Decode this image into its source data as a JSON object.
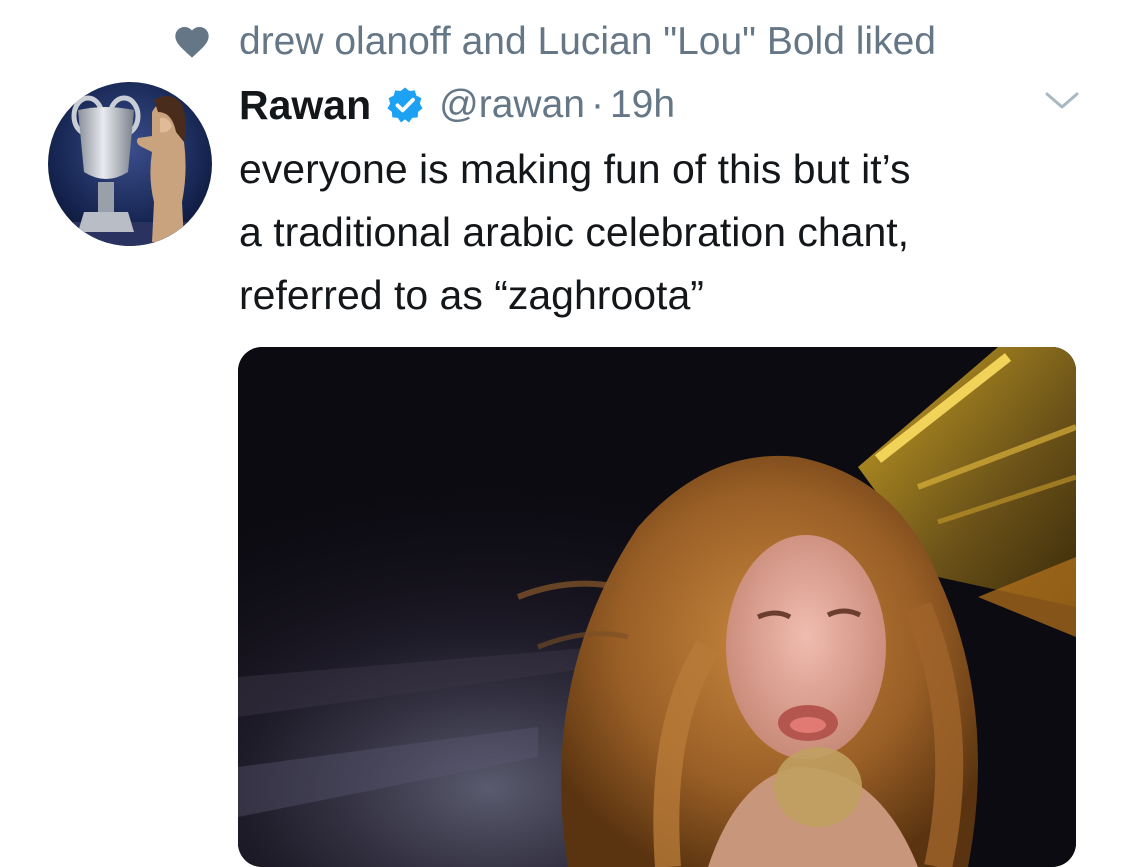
{
  "social_context": {
    "icon": "heart-icon",
    "text": "drew olanoff and Lucian \"Lou\" Bold liked"
  },
  "tweet": {
    "display_name": "Rawan",
    "verified_icon": "verified-badge-icon",
    "handle": "@rawan",
    "separator": "·",
    "time": "19h",
    "menu_icon": "chevron-down-icon",
    "text_lines": [
      "everyone is making fun of this but it’s",
      "a traditional arabic celebration chant,",
      "referred to as “zaghroota”"
    ]
  },
  "colors": {
    "primary_text": "#14171a",
    "secondary_text": "#657786",
    "verified_blue": "#1da1f2",
    "heart_gray": "#657786"
  }
}
